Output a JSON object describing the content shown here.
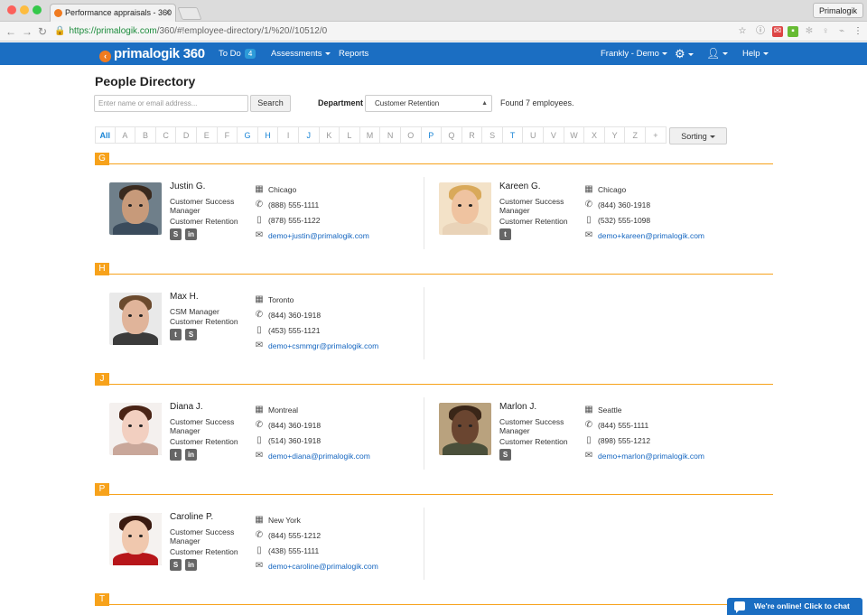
{
  "browser": {
    "tab_title": "Performance appraisals - 360",
    "profile": "Primalogik",
    "url_lock": "🔒",
    "url_host": "https://primalogik.com",
    "url_path": "/360/#!employee-directory/1/%20//10512/0"
  },
  "navbar": {
    "logo": "primalogik 360",
    "todo_label": "To Do",
    "todo_count": "4",
    "assessments": "Assessments",
    "reports": "Reports",
    "user": "Frankly - Demo",
    "help": "Help"
  },
  "page_title": "People Directory",
  "search": {
    "placeholder": "Enter name or email address...",
    "button": "Search"
  },
  "department": {
    "label": "Department",
    "value": "Customer Retention"
  },
  "found_text": "Found 7 employees.",
  "alphabet": [
    {
      "l": "All",
      "on": true
    },
    {
      "l": "A"
    },
    {
      "l": "B"
    },
    {
      "l": "C"
    },
    {
      "l": "D"
    },
    {
      "l": "E"
    },
    {
      "l": "F"
    },
    {
      "l": "G",
      "on": true
    },
    {
      "l": "H",
      "on": true
    },
    {
      "l": "I"
    },
    {
      "l": "J",
      "on": true
    },
    {
      "l": "K"
    },
    {
      "l": "L"
    },
    {
      "l": "M"
    },
    {
      "l": "N"
    },
    {
      "l": "O"
    },
    {
      "l": "P",
      "on": true
    },
    {
      "l": "Q"
    },
    {
      "l": "R"
    },
    {
      "l": "S"
    },
    {
      "l": "T",
      "on": true
    },
    {
      "l": "U"
    },
    {
      "l": "V"
    },
    {
      "l": "W"
    },
    {
      "l": "X"
    },
    {
      "l": "Y"
    },
    {
      "l": "Z"
    },
    {
      "l": "+"
    }
  ],
  "sorting_label": "Sorting",
  "sections": [
    {
      "letter": "G",
      "people": [
        {
          "name": "Justin G.",
          "title": "Customer Success Manager",
          "dept": "Customer Retention",
          "socials": [
            "skype",
            "linkedin"
          ],
          "city": "Chicago",
          "phone": "(888) 555-1111",
          "mobile": "(878) 555-1122",
          "email": "demo+justin@primalogik.com",
          "skin": "#c79a7a",
          "hair": "#3a2a1e",
          "shirt": "#3a4b5c",
          "bgc": "#6f7f8a"
        },
        {
          "name": "Kareen G.",
          "title": "Customer Success Manager",
          "dept": "Customer Retention",
          "socials": [
            "twitter"
          ],
          "city": "Chicago",
          "phone": "(844) 360-1918",
          "mobile": "(532) 555-1098",
          "email": "demo+kareen@primalogik.com",
          "skin": "#efc3a0",
          "hair": "#d9a95a",
          "shirt": "#e9d3b8",
          "bgc": "#f3e2c8"
        }
      ]
    },
    {
      "letter": "H",
      "people": [
        {
          "name": "Max H.",
          "title": "CSM Manager",
          "dept": "Customer Retention",
          "socials": [
            "twitter",
            "skype"
          ],
          "city": "Toronto",
          "phone": "(844) 360-1918",
          "mobile": "(453) 555-1121",
          "email": "demo+csmmgr@primalogik.com",
          "skin": "#e0b49a",
          "hair": "#6b4a2e",
          "shirt": "#3b3b3b",
          "bgc": "#e9e9e9"
        }
      ]
    },
    {
      "letter": "J",
      "people": [
        {
          "name": "Diana J.",
          "title": "Customer Success Manager",
          "dept": "Customer Retention",
          "socials": [
            "twitter",
            "linkedin"
          ],
          "city": "Montreal",
          "phone": "(844) 360-1918",
          "mobile": "(514) 360-1918",
          "email": "demo+diana@primalogik.com",
          "skin": "#f2cfc0",
          "hair": "#4a2416",
          "shirt": "#c9a79a",
          "bgc": "#f4f0ee"
        },
        {
          "name": "Marlon J.",
          "title": "Customer Success Manager",
          "dept": "Customer Retention",
          "socials": [
            "skype"
          ],
          "city": "Seattle",
          "phone": "(844) 555-1111",
          "mobile": "(898) 555-1212",
          "email": "demo+marlon@primalogik.com",
          "skin": "#6a4530",
          "hair": "#3a2618",
          "shirt": "#4a4f3a",
          "bgc": "#b9a27e"
        }
      ]
    },
    {
      "letter": "P",
      "people": [
        {
          "name": "Caroline P.",
          "title": "Customer Success Manager",
          "dept": "Customer Retention",
          "socials": [
            "skype",
            "linkedin"
          ],
          "city": "New York",
          "phone": "(844) 555-1212",
          "mobile": "(438) 555-1111",
          "email": "demo+caroline@primalogik.com",
          "skin": "#f0c8ae",
          "hair": "#3a1a10",
          "shirt": "#b7161a",
          "bgc": "#f5f2f0"
        }
      ]
    },
    {
      "letter": "T",
      "people": []
    }
  ],
  "chat": "We're online! Click to chat"
}
